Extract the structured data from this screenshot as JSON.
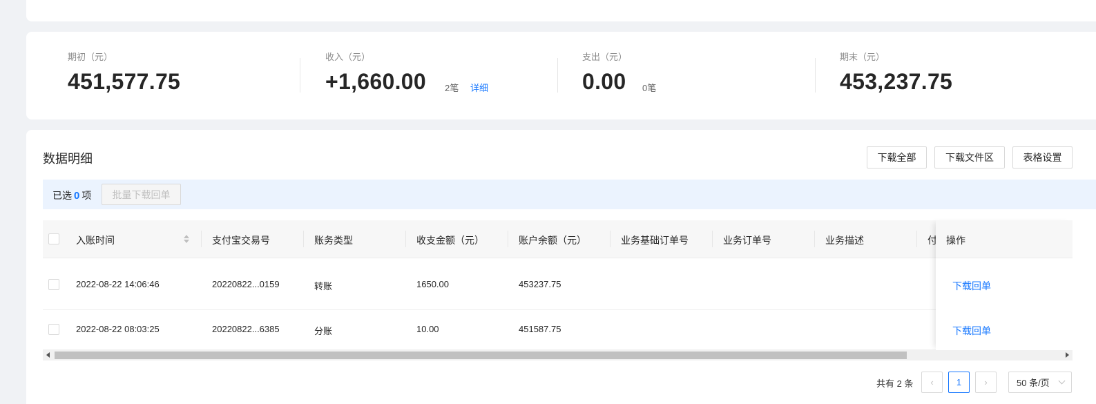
{
  "summary": {
    "opening": {
      "label": "期初（元）",
      "value": "451,577.75"
    },
    "income": {
      "label": "收入（元）",
      "value": "+1,660.00",
      "count": "2笔",
      "detail_link": "详细"
    },
    "expense": {
      "label": "支出（元）",
      "value": "0.00",
      "count": "0笔"
    },
    "closing": {
      "label": "期末（元）",
      "value": "453,237.75"
    }
  },
  "detail": {
    "title": "数据明细",
    "buttons": {
      "download_all": "下载全部",
      "download_area": "下载文件区",
      "table_settings": "表格设置"
    },
    "selection": {
      "prefix": "已选",
      "count": "0",
      "suffix": "项",
      "bulk_button": "批量下载回单"
    }
  },
  "table": {
    "columns": [
      "入账时间",
      "支付宝交易号",
      "账务类型",
      "收支金额（元）",
      "账户余额（元）",
      "业务基础订单号",
      "业务订单号",
      "业务描述",
      "付",
      "操作"
    ],
    "rows": [
      {
        "time": "2022-08-22 14:06:46",
        "trade_no": "20220822...0159",
        "type": "转账",
        "amount": "1650.00",
        "balance": "453237.75",
        "action": "下载回单"
      },
      {
        "time": "2022-08-22 08:03:25",
        "trade_no": "20220822...6385",
        "type": "分账",
        "amount": "10.00",
        "balance": "451587.75",
        "action": "下载回单"
      }
    ]
  },
  "pagination": {
    "total": "共有 2 条",
    "current_page": "1",
    "page_size": "50 条/页",
    "prev_icon": "‹",
    "next_icon": "›"
  }
}
